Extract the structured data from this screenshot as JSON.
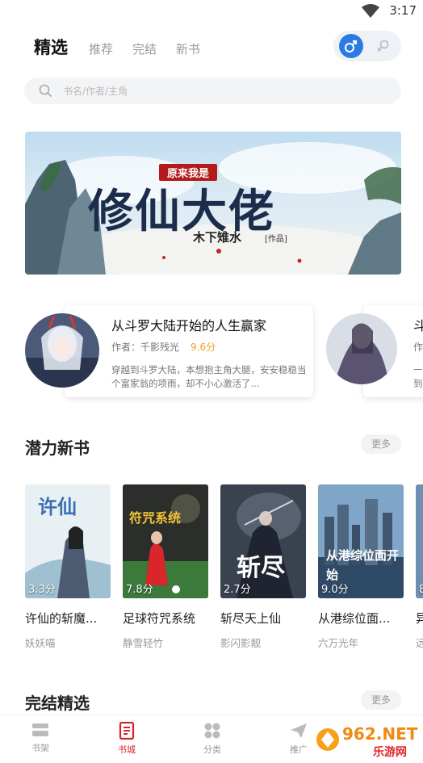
{
  "status_bar": {
    "time": "3:17"
  },
  "top_tabs": [
    {
      "label": "精选",
      "active": true
    },
    {
      "label": "推荐",
      "active": false
    },
    {
      "label": "完结",
      "active": false
    },
    {
      "label": "新书",
      "active": false
    }
  ],
  "gender_toggle": {
    "selected": "male",
    "icons": [
      "male-icon",
      "female-icon"
    ]
  },
  "search": {
    "placeholder": "书名/作者/主角"
  },
  "banner": {
    "pre_title": "原来我是",
    "title": "修仙大佬",
    "author": "木下雉水",
    "author_tag": "[作品]"
  },
  "featured": [
    {
      "title": "从斗罗大陆开始的人生赢家",
      "author_prefix": "作者：",
      "author": "千影残光",
      "score": "9.6分",
      "desc": "穿越到斗罗大陆，本想抱主角大腿，安安稳稳当个富家翁的项雨，却不小心激活了..."
    },
    {
      "title": "斗",
      "author_prefix": "作",
      "desc": "一 到"
    }
  ],
  "potential": {
    "title": "潜力新书",
    "more": "更多",
    "books": [
      {
        "name": "许仙的斩魔...",
        "author": "妖妖喵",
        "rating": "3.3分",
        "cover_text": "许仙"
      },
      {
        "name": "足球符咒系统",
        "author": "静雪轻竹",
        "rating": "7.8分",
        "cover_text": "符咒系统"
      },
      {
        "name": "斩尽天上仙",
        "author": "影闪影靓",
        "rating": "2.7分",
        "cover_text": "斩尽"
      },
      {
        "name": "从港综位面...",
        "author": "六万光年",
        "rating": "9.0分",
        "cover_text": "从港综位面开始"
      },
      {
        "name": "异",
        "author": "远",
        "rating": "8"
      }
    ]
  },
  "finished": {
    "title": "完结精选",
    "more": "更多"
  },
  "bottom_nav": [
    {
      "label": "书架",
      "icon": "bookshelf-icon",
      "active": false
    },
    {
      "label": "书城",
      "icon": "bookstore-icon",
      "active": true
    },
    {
      "label": "分类",
      "icon": "category-icon",
      "active": false
    },
    {
      "label": "推广",
      "icon": "promote-icon",
      "active": false
    }
  ],
  "watermark": {
    "text": "962.NET",
    "sub": "乐游网"
  },
  "colors": {
    "accent_red": "#d4252a",
    "male_blue": "#2b7be5",
    "score_orange": "#f0a020"
  }
}
